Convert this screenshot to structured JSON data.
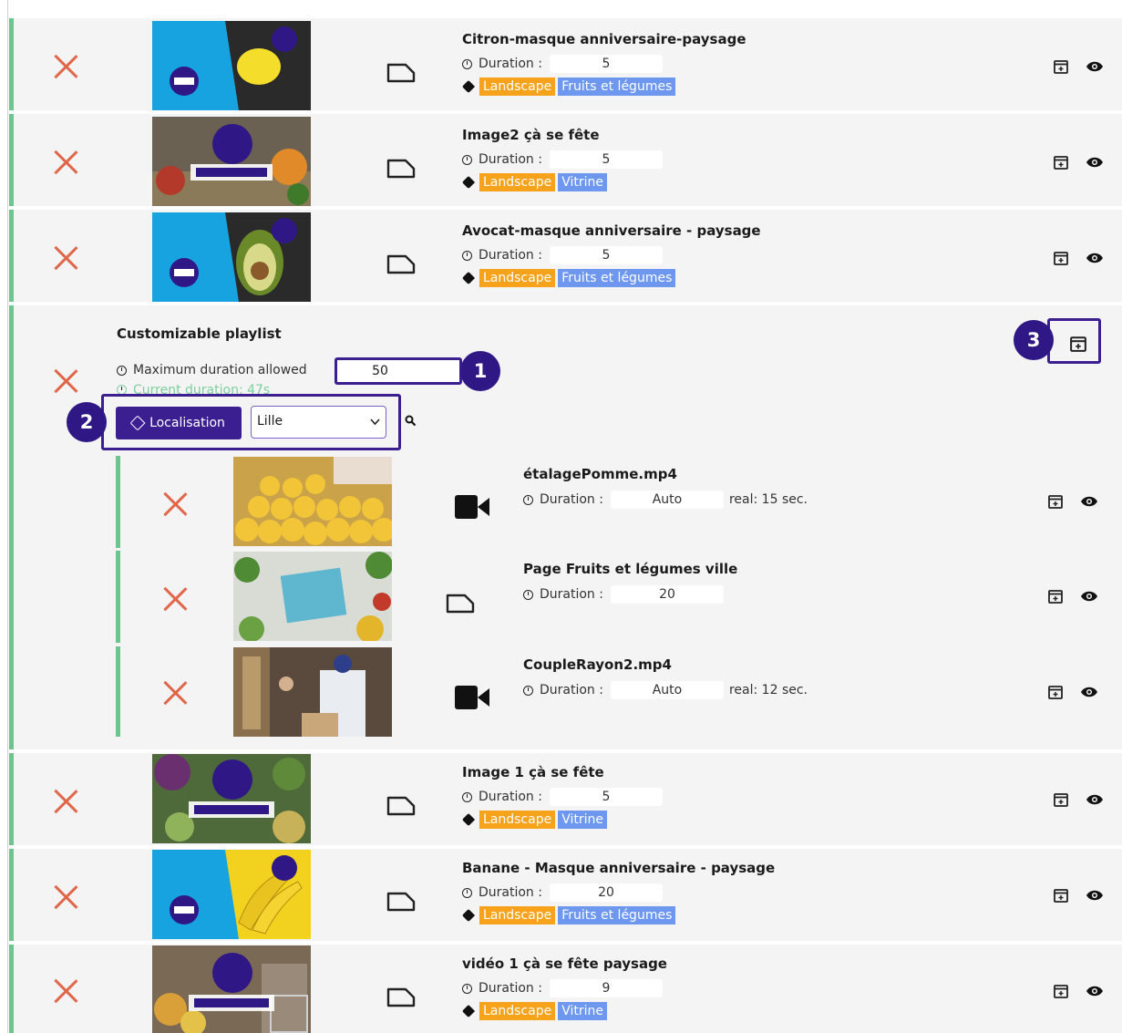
{
  "colors": {
    "accent": "#3b1f91",
    "delete": "#e0674a",
    "row_border": "#6cc48f",
    "tag_orange": "#f7a21b",
    "tag_blue": "#6e97ef"
  },
  "labels": {
    "duration": "Duration :"
  },
  "items": [
    {
      "title": "Citron-masque anniversaire-paysage",
      "duration": "5",
      "tags": [
        "Landscape",
        "Fruits et légumes"
      ],
      "type": "image"
    },
    {
      "title": "Image2 çà se fête",
      "duration": "5",
      "tags": [
        "Landscape",
        "Vitrine"
      ],
      "type": "image"
    },
    {
      "title": "Avocat-masque anniversaire - paysage",
      "duration": "5",
      "tags": [
        "Landscape",
        "Fruits et légumes"
      ],
      "type": "image"
    }
  ],
  "playlist": {
    "title": "Customizable playlist",
    "max_label": "Maximum duration allowed",
    "max_value": "50",
    "current_label": "Current duration: 47s",
    "filter_button": "Localisation",
    "filter_select": "Lille",
    "callouts": [
      "1",
      "2",
      "3"
    ],
    "children": [
      {
        "title": "étalagePomme.mp4",
        "duration": "Auto",
        "real": "real: 15 sec.",
        "type": "video"
      },
      {
        "title": "Page Fruits et légumes ville",
        "duration": "20",
        "real": "",
        "type": "image"
      },
      {
        "title": "CoupleRayon2.mp4",
        "duration": "Auto",
        "real": "real: 12 sec.",
        "type": "video"
      }
    ]
  },
  "items_after": [
    {
      "title": "Image 1 çà se fête",
      "duration": "5",
      "tags": [
        "Landscape",
        "Vitrine"
      ],
      "type": "image"
    },
    {
      "title": "Banane - Masque anniversaire - paysage",
      "duration": "20",
      "tags": [
        "Landscape",
        "Fruits et légumes"
      ],
      "type": "image"
    },
    {
      "title": "vidéo 1 çà se fête paysage",
      "duration": "9",
      "tags": [
        "Landscape",
        "Vitrine"
      ],
      "type": "image"
    }
  ]
}
